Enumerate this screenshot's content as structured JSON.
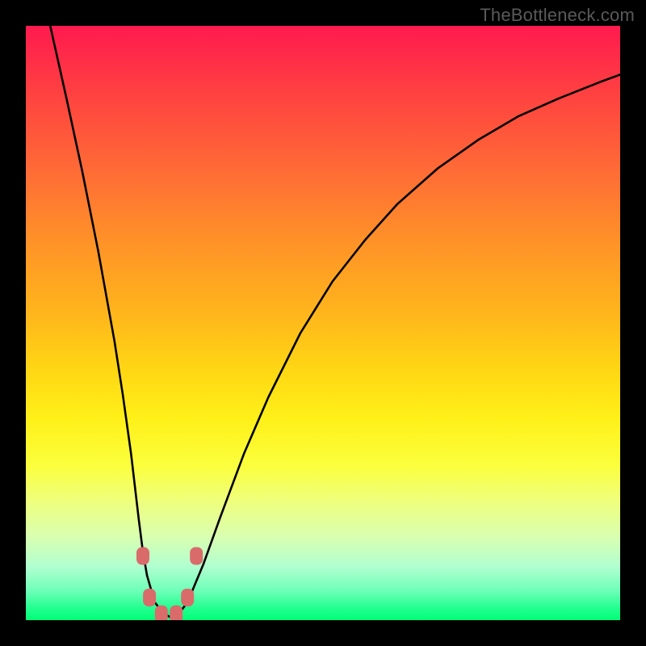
{
  "watermark": "TheBottleneck.com",
  "colors": {
    "frame": "#000000",
    "bead": "#d96b6b",
    "curve": "#000000"
  },
  "chart_data": {
    "type": "line",
    "title": "",
    "xlabel": "",
    "ylabel": "",
    "xlim": [
      0,
      1
    ],
    "ylim": [
      0,
      1
    ],
    "note": "Axes are unlabeled in the image; data points are estimated from pixel positions on a normalized 0–1 plot area where (0,0) is bottom-left.",
    "series": [
      {
        "name": "curve",
        "x": [
          0.041,
          0.068,
          0.095,
          0.122,
          0.149,
          0.163,
          0.177,
          0.19,
          0.197,
          0.204,
          0.217,
          0.231,
          0.245,
          0.258,
          0.272,
          0.299,
          0.326,
          0.367,
          0.408,
          0.462,
          0.516,
          0.571,
          0.625,
          0.693,
          0.761,
          0.829,
          0.897,
          0.965,
          1.0
        ],
        "y": [
          1.0,
          0.88,
          0.755,
          0.62,
          0.47,
          0.38,
          0.28,
          0.17,
          0.115,
          0.075,
          0.03,
          0.012,
          0.004,
          0.012,
          0.03,
          0.095,
          0.17,
          0.28,
          0.375,
          0.483,
          0.57,
          0.64,
          0.7,
          0.76,
          0.808,
          0.848,
          0.878,
          0.905,
          0.918
        ]
      }
    ],
    "markers": [
      {
        "x": 0.197,
        "y": 0.108
      },
      {
        "x": 0.287,
        "y": 0.108
      },
      {
        "x": 0.208,
        "y": 0.038
      },
      {
        "x": 0.272,
        "y": 0.038
      },
      {
        "x": 0.228,
        "y": 0.01
      },
      {
        "x": 0.253,
        "y": 0.01
      }
    ]
  }
}
